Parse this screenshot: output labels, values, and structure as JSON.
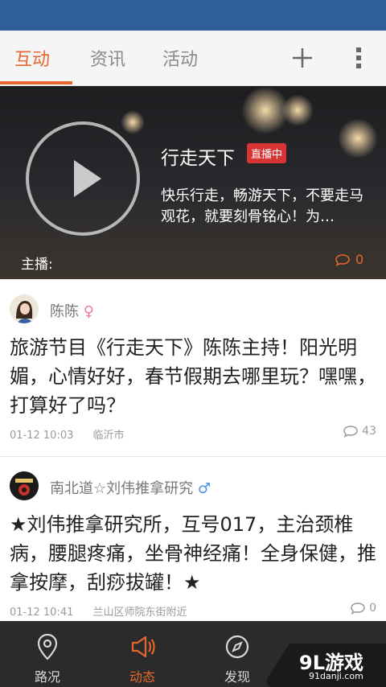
{
  "tabs": [
    {
      "label": "互动",
      "active": true
    },
    {
      "label": "资讯",
      "active": false
    },
    {
      "label": "活动",
      "active": false
    }
  ],
  "header_icons": [
    "plus-icon",
    "more-vertical-icon"
  ],
  "banner": {
    "title": "行走天下",
    "live_badge": "直播中",
    "description": "快乐行走，畅游天下，不要走马观花，就要刻骨铭心！为…",
    "host_label": "主播:",
    "comment_count": "0"
  },
  "posts": [
    {
      "author": "陈陈",
      "gender_symbol": "♀",
      "content": "旅游节目《行走天下》陈陈主持！阳光明媚，心情好好，春节假期去哪里玩？嘿嘿，打算好了吗？",
      "time": "01-12 10:03",
      "location": "临沂市",
      "comment_count": "43"
    },
    {
      "author": "南北道☆刘伟推拿研究",
      "gender_symbol": "♂",
      "content": "★刘伟推拿研究所，互号017，主治颈椎病，腰腿疼痛，坐骨神经痛！全身保健，推拿按摩，刮痧拔罐！★",
      "time": "01-12 10:41",
      "location": "兰山区师院东街附近",
      "comment_count": "0"
    }
  ],
  "bottom_nav": [
    {
      "label": "路况",
      "icon": "location-pin-icon",
      "active": false
    },
    {
      "label": "动态",
      "icon": "megaphone-icon",
      "active": true
    },
    {
      "label": "发现",
      "icon": "compass-icon",
      "active": false
    }
  ],
  "watermark": {
    "main": "9L游戏",
    "sub": "91danji.com"
  },
  "colors": {
    "accent": "#e8662c",
    "status_bar": "#2f5f99",
    "nav_bg": "#2b2b2b"
  }
}
